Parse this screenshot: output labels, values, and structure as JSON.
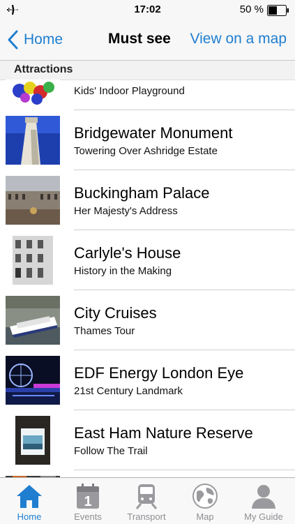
{
  "status_bar": {
    "time": "17:02",
    "battery": "50 %"
  },
  "nav": {
    "back_label": "Home",
    "title": "Must see",
    "right_action": "View on a map"
  },
  "section": {
    "title": "Attractions"
  },
  "list": {
    "items": [
      {
        "title": "",
        "subtitle": "Kids' Indoor Playground"
      },
      {
        "title": "Bridgewater Monument",
        "subtitle": "Towering Over Ashridge Estate"
      },
      {
        "title": "Buckingham Palace",
        "subtitle": "Her Majesty's Address"
      },
      {
        "title": "Carlyle's House",
        "subtitle": "History in the Making"
      },
      {
        "title": "City Cruises",
        "subtitle": "Thames Tour"
      },
      {
        "title": "EDF Energy London Eye",
        "subtitle": "21st Century Landmark"
      },
      {
        "title": "East Ham Nature Reserve",
        "subtitle": "Follow The Trail"
      }
    ]
  },
  "tabs": [
    {
      "label": "Home",
      "icon": "house-icon",
      "active": true
    },
    {
      "label": "Events",
      "icon": "calendar-icon",
      "active": false
    },
    {
      "label": "Transport",
      "icon": "train-icon",
      "active": false
    },
    {
      "label": "Map",
      "icon": "globe-icon",
      "active": false
    },
    {
      "label": "My Guide",
      "icon": "person-icon",
      "active": false
    }
  ],
  "colors": {
    "accent": "#1f7ed0",
    "inactive": "#8e8e93"
  }
}
